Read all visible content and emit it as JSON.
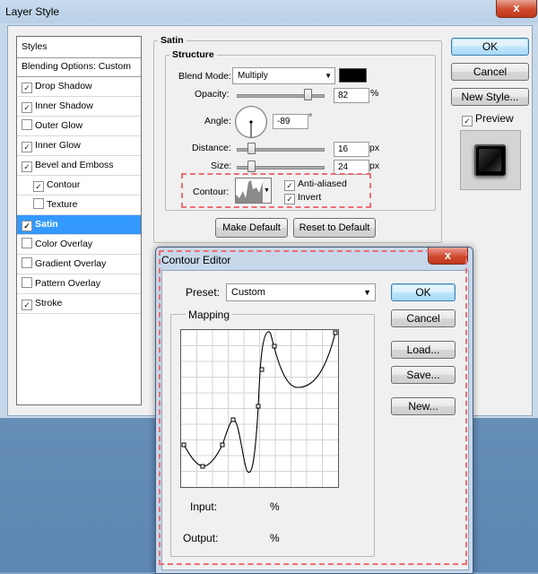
{
  "window": {
    "title": "Layer Style",
    "close_glyph": "x"
  },
  "styles_panel": {
    "header": "Styles",
    "items": [
      {
        "label": "Blending Options: Custom",
        "checkbox": false,
        "checked": false,
        "indent": false,
        "selected": false
      },
      {
        "label": "Drop Shadow",
        "checkbox": true,
        "checked": true,
        "indent": false,
        "selected": false
      },
      {
        "label": "Inner Shadow",
        "checkbox": true,
        "checked": true,
        "indent": false,
        "selected": false
      },
      {
        "label": "Outer Glow",
        "checkbox": true,
        "checked": false,
        "indent": false,
        "selected": false
      },
      {
        "label": "Inner Glow",
        "checkbox": true,
        "checked": true,
        "indent": false,
        "selected": false
      },
      {
        "label": "Bevel and Emboss",
        "checkbox": true,
        "checked": true,
        "indent": false,
        "selected": false
      },
      {
        "label": "Contour",
        "checkbox": true,
        "checked": true,
        "indent": true,
        "selected": false
      },
      {
        "label": "Texture",
        "checkbox": true,
        "checked": false,
        "indent": true,
        "selected": false
      },
      {
        "label": "Satin",
        "checkbox": true,
        "checked": true,
        "indent": false,
        "selected": true
      },
      {
        "label": "Color Overlay",
        "checkbox": true,
        "checked": false,
        "indent": false,
        "selected": false
      },
      {
        "label": "Gradient Overlay",
        "checkbox": true,
        "checked": false,
        "indent": false,
        "selected": false
      },
      {
        "label": "Pattern Overlay",
        "checkbox": true,
        "checked": false,
        "indent": false,
        "selected": false
      },
      {
        "label": "Stroke",
        "checkbox": true,
        "checked": true,
        "indent": false,
        "selected": false
      }
    ]
  },
  "satin": {
    "group_title": "Satin",
    "structure_title": "Structure",
    "blend_mode_label": "Blend Mode:",
    "blend_mode_value": "Multiply",
    "blend_color": "#000000",
    "opacity_label": "Opacity:",
    "opacity_value": "82",
    "opacity_fraction": 0.82,
    "opacity_unit": "%",
    "angle_label": "Angle:",
    "angle_value": "-89",
    "angle_unit": "°",
    "distance_label": "Distance:",
    "distance_value": "16",
    "distance_unit": "px",
    "size_label": "Size:",
    "size_value": "24",
    "size_unit": "px",
    "contour_label": "Contour:",
    "anti_aliased_label": "Anti-aliased",
    "anti_aliased_checked": true,
    "invert_label": "Invert",
    "invert_checked": true,
    "make_default_label": "Make Default",
    "reset_default_label": "Reset to Default"
  },
  "right_buttons": {
    "ok_label": "OK",
    "cancel_label": "Cancel",
    "new_style_label": "New Style...",
    "preview_label": "Preview",
    "preview_checked": true
  },
  "contour_editor": {
    "title": "Contour Editor",
    "close_glyph": "x",
    "preset_label": "Preset:",
    "preset_value": "Custom",
    "mapping_label": "Mapping",
    "input_label": "Input:",
    "input_unit": "%",
    "output_label": "Output:",
    "output_unit": "%",
    "ok_label": "OK",
    "cancel_label": "Cancel",
    "load_label": "Load...",
    "save_label": "Save...",
    "new_label": "New..."
  },
  "colors": {
    "selection": "#3399ff",
    "annotation_dash": "#ee6e74",
    "window_frame": "#c7d8ea"
  }
}
